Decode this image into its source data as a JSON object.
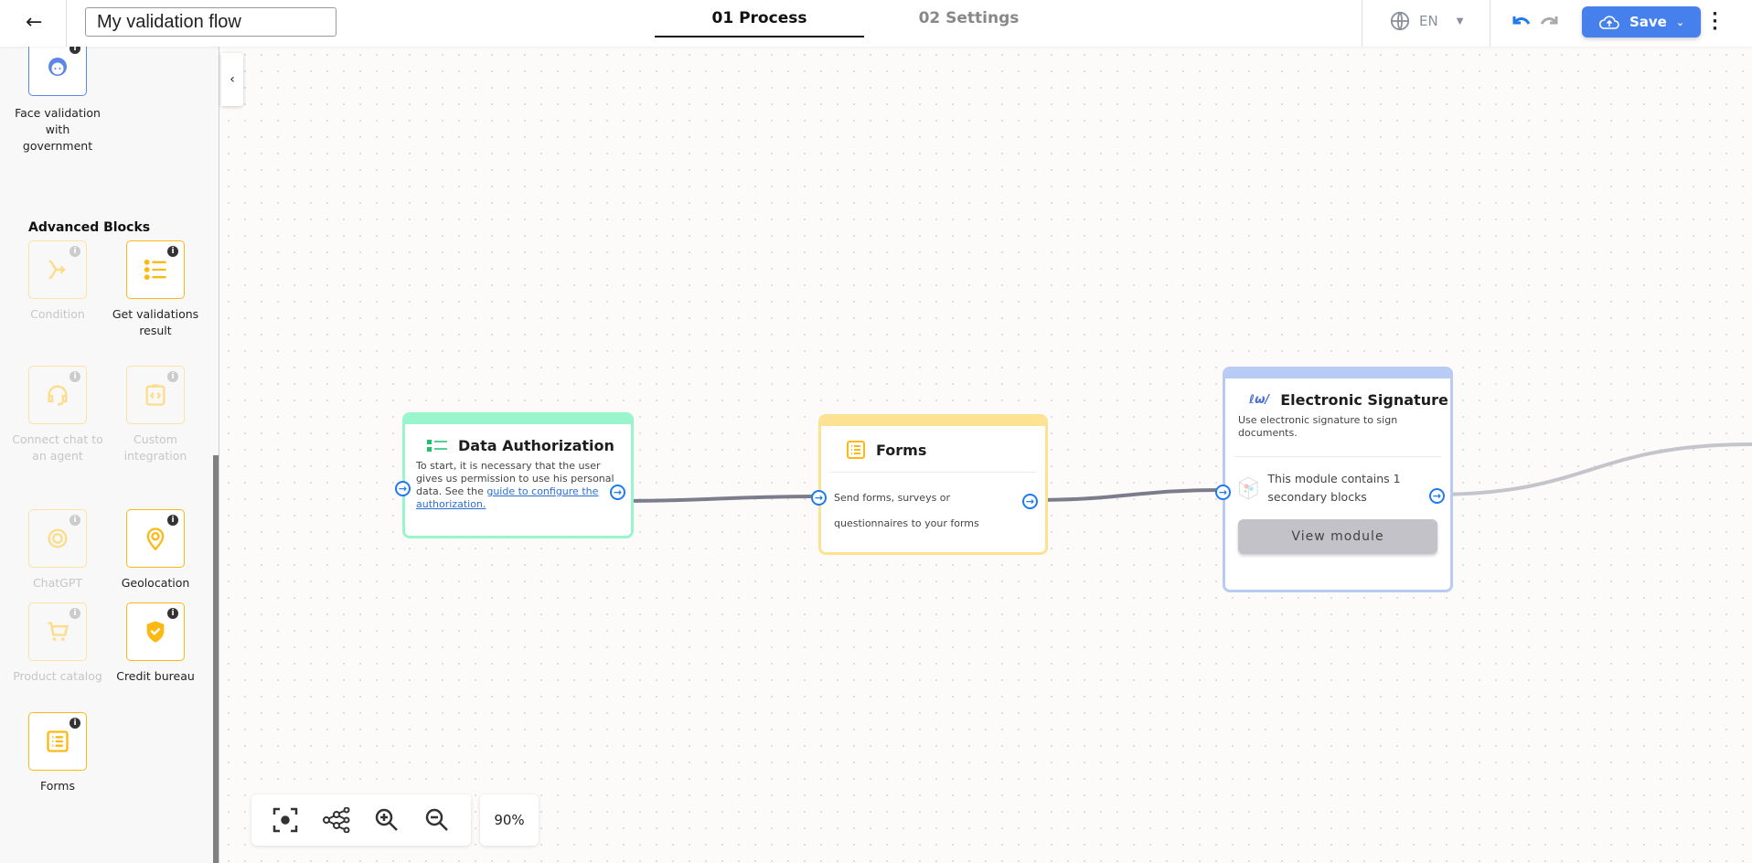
{
  "header": {
    "title_value": "My validation flow",
    "tabs": [
      {
        "label": "01 Process",
        "active": true
      },
      {
        "label": "02 Settings",
        "active": false
      }
    ],
    "language": "EN",
    "save_label": "Save"
  },
  "sidebar": {
    "top_item": {
      "label": "Face validation with government",
      "icon": "face-icon"
    },
    "section_title": "Advanced Blocks",
    "items": [
      {
        "label": "Condition",
        "enabled": false,
        "icon": "branch-icon"
      },
      {
        "label": "Get validations result",
        "enabled": true,
        "icon": "checklist-icon"
      },
      {
        "label": "Connect chat to an agent",
        "enabled": false,
        "icon": "headset-icon"
      },
      {
        "label": "Custom integration",
        "enabled": false,
        "icon": "code-clipboard-icon"
      },
      {
        "label": "ChatGPT",
        "enabled": false,
        "icon": "chatgpt-icon"
      },
      {
        "label": "Geolocation",
        "enabled": true,
        "icon": "location-pin-icon"
      },
      {
        "label": "Product catalog",
        "enabled": false,
        "icon": "cart-icon"
      },
      {
        "label": "Credit bureau",
        "enabled": true,
        "icon": "shield-user-icon"
      },
      {
        "label": "Forms",
        "enabled": true,
        "icon": "form-list-icon"
      }
    ]
  },
  "nodes": {
    "data_auth": {
      "title": "Data Authorization",
      "text": "To start, it is necessary that the user gives us permission to use his personal data. See the ",
      "link": "guide to configure the authorization.",
      "color": "#98f5cc"
    },
    "forms": {
      "title": "Forms",
      "text": "Send forms, surveys or questionnaires to your forms",
      "color": "#fde293"
    },
    "esign": {
      "title": "Electronic Signature",
      "text": "Use electronic signature to sign documents.",
      "module_text": "This module contains 1 secondary blocks",
      "button": "View module",
      "color": "#b8cbf5"
    }
  },
  "zoom": {
    "level": "90%"
  },
  "colors": {
    "accent": "#4680ec",
    "block": "#fdb913",
    "port": "#1f7af0"
  }
}
